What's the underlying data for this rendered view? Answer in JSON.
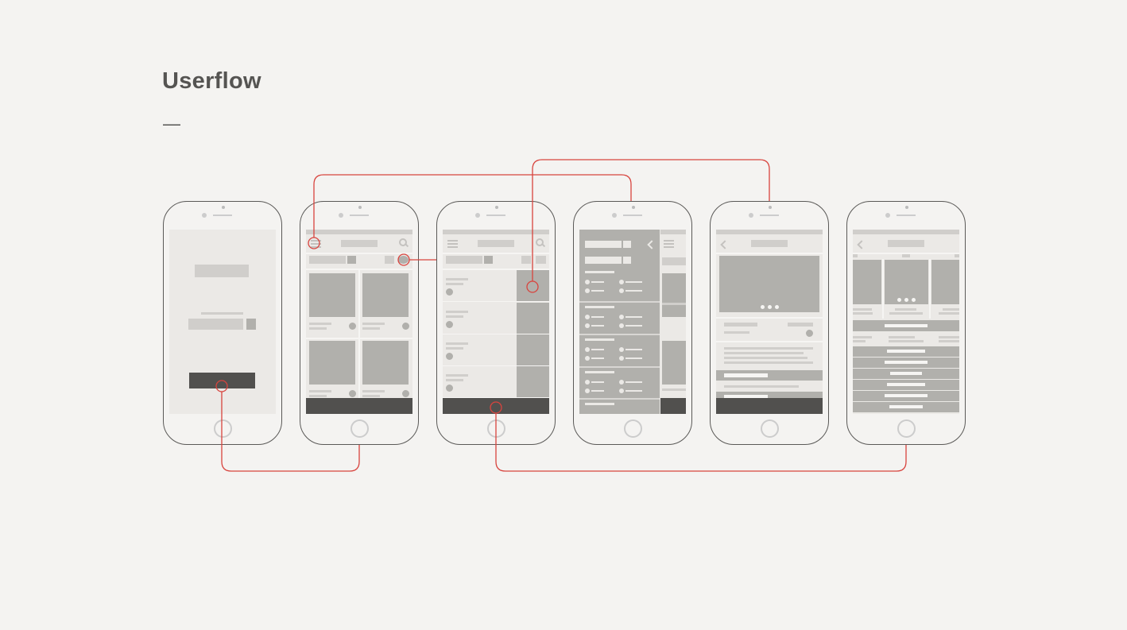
{
  "page": {
    "title": "Userflow",
    "divider": "—"
  },
  "colors": {
    "background": "#f4f3f1",
    "connector": "#d8443e",
    "screen": "#ebe9e6",
    "block_light": "#d0cecb",
    "block_mid": "#b1b0ac",
    "block_dark": "#51504e"
  },
  "screens": [
    {
      "name": "login"
    },
    {
      "name": "product-grid"
    },
    {
      "name": "product-list"
    },
    {
      "name": "filter-drawer"
    },
    {
      "name": "product-detail"
    },
    {
      "name": "product-options"
    }
  ]
}
